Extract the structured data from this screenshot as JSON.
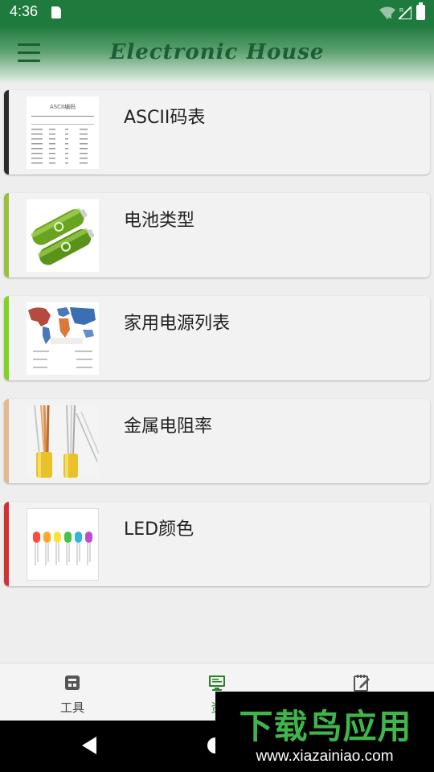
{
  "status_bar": {
    "time": "4:36",
    "signal_roaming": "R"
  },
  "app_bar": {
    "title": "Electronic House",
    "menu_icon": "hamburger-menu-icon"
  },
  "list": {
    "items": [
      {
        "label": "ASCII码表",
        "accent": "#2b2b2b",
        "thumb_caption": "ASCII编码",
        "thumb_icon": "ascii-table-thumbnail"
      },
      {
        "label": "电池类型",
        "accent": "#9bbf3b",
        "thumb_icon": "battery-thumbnail"
      },
      {
        "label": "家用电源列表",
        "accent": "#7ed321",
        "thumb_icon": "world-map-thumbnail"
      },
      {
        "label": "金属电阻率",
        "accent": "#e3b98f",
        "thumb_icon": "copper-wire-thumbnail"
      },
      {
        "label": "LED颜色",
        "accent": "#d32f2f",
        "thumb_icon": "led-colors-thumbnail"
      }
    ]
  },
  "bottom_nav": {
    "items": [
      {
        "label": "工具",
        "icon": "toolbox-icon",
        "active": false
      },
      {
        "label": "资",
        "icon": "monitor-icon",
        "active": true
      },
      {
        "label": "",
        "icon": "notepad-edit-icon",
        "active": false
      }
    ],
    "active_color": "#2e7d32"
  },
  "system_nav": {
    "back": "back-icon",
    "home": "home-icon"
  },
  "watermark": {
    "title": "下载鸟应用",
    "url": "www.xiazainiao.com"
  }
}
